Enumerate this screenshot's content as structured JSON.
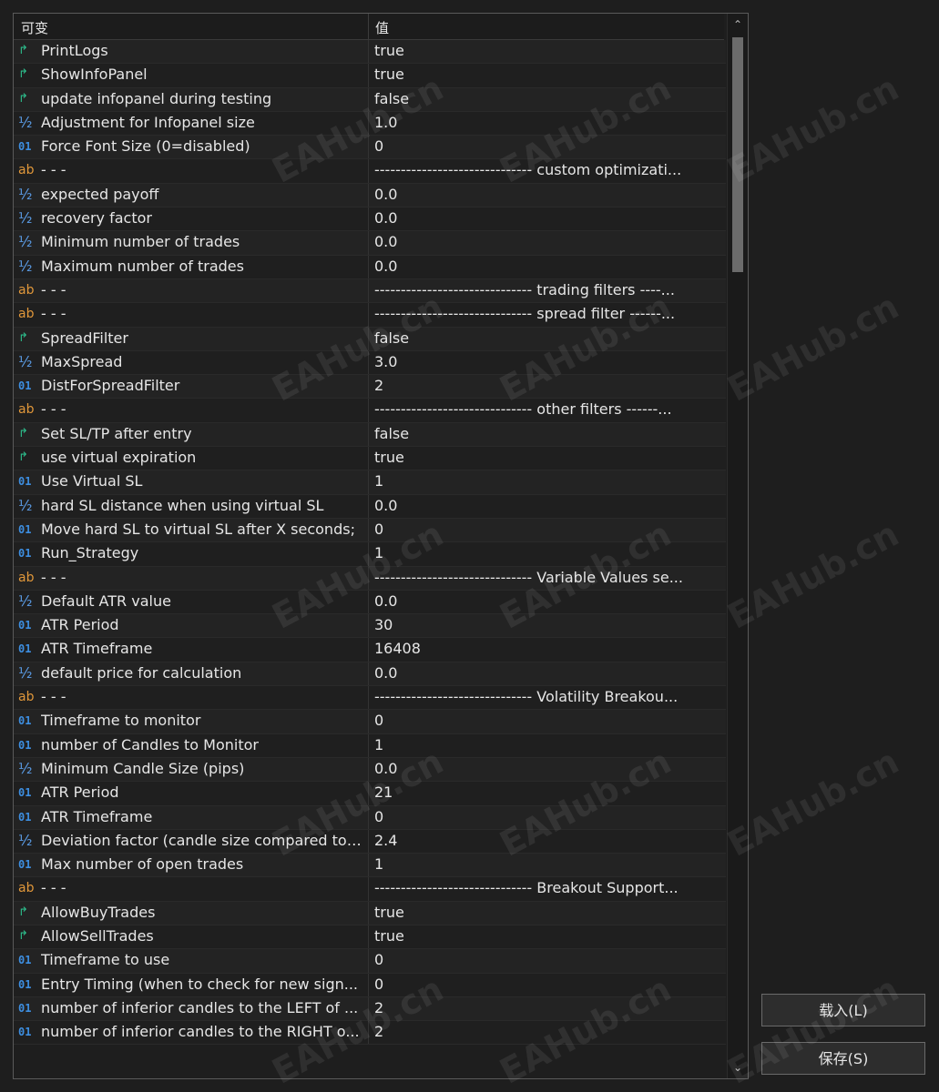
{
  "header": {
    "col_name": "可变",
    "col_value": "值"
  },
  "params": [
    {
      "type": "bool",
      "name": "PrintLogs",
      "value": "true"
    },
    {
      "type": "bool",
      "name": "ShowInfoPanel",
      "value": "true"
    },
    {
      "type": "bool",
      "name": "update infopanel during testing",
      "value": "false"
    },
    {
      "type": "double",
      "name": "Adjustment for Infopanel size",
      "value": "1.0"
    },
    {
      "type": "int",
      "name": "Force Font Size (0=disabled)",
      "value": "0"
    },
    {
      "type": "string",
      "name": "- - -",
      "value": "------------------------------ custom optimizati..."
    },
    {
      "type": "double",
      "name": "expected payoff",
      "value": "0.0"
    },
    {
      "type": "double",
      "name": "recovery factor",
      "value": "0.0"
    },
    {
      "type": "double",
      "name": "Minimum number of trades",
      "value": "0.0"
    },
    {
      "type": "double",
      "name": "Maximum number of trades",
      "value": "0.0"
    },
    {
      "type": "string",
      "name": "- - -",
      "value": "------------------------------ trading filters ----..."
    },
    {
      "type": "string",
      "name": "- - -",
      "value": "------------------------------ spread filter ------..."
    },
    {
      "type": "bool",
      "name": "SpreadFilter",
      "value": "false"
    },
    {
      "type": "double",
      "name": "MaxSpread",
      "value": "3.0"
    },
    {
      "type": "int",
      "name": "DistForSpreadFilter",
      "value": "2"
    },
    {
      "type": "string",
      "name": "- - -",
      "value": "------------------------------ other filters ------..."
    },
    {
      "type": "bool",
      "name": "Set SL/TP after entry",
      "value": "false"
    },
    {
      "type": "bool",
      "name": "use virtual expiration",
      "value": "true"
    },
    {
      "type": "int",
      "name": "Use Virtual SL",
      "value": "1"
    },
    {
      "type": "double",
      "name": "hard SL distance when using virtual SL",
      "value": "0.0"
    },
    {
      "type": "int",
      "name": "Move hard SL to virtual SL after X seconds;",
      "value": "0"
    },
    {
      "type": "int",
      "name": "Run_Strategy",
      "value": "1"
    },
    {
      "type": "string",
      "name": "- - -",
      "value": "------------------------------ Variable Values se..."
    },
    {
      "type": "double",
      "name": "Default ATR value",
      "value": "0.0"
    },
    {
      "type": "int",
      "name": "ATR Period",
      "value": "30"
    },
    {
      "type": "int",
      "name": "ATR Timeframe",
      "value": "16408"
    },
    {
      "type": "double",
      "name": "default price for calculation",
      "value": "0.0"
    },
    {
      "type": "string",
      "name": "- - -",
      "value": "------------------------------ Volatility Breakou..."
    },
    {
      "type": "int",
      "name": "Timeframe to monitor",
      "value": "0"
    },
    {
      "type": "int",
      "name": "number of Candles to Monitor",
      "value": "1"
    },
    {
      "type": "double",
      "name": "Minimum Candle Size (pips)",
      "value": "0.0"
    },
    {
      "type": "int",
      "name": "ATR Period",
      "value": "21"
    },
    {
      "type": "int",
      "name": "ATR Timeframe",
      "value": "0"
    },
    {
      "type": "double",
      "name": "Deviation factor (candle size compared to ...",
      "value": "2.4"
    },
    {
      "type": "int",
      "name": "Max number of open trades",
      "value": "1"
    },
    {
      "type": "string",
      "name": "- - -",
      "value": "------------------------------ Breakout Support..."
    },
    {
      "type": "bool",
      "name": "AllowBuyTrades",
      "value": "true"
    },
    {
      "type": "bool",
      "name": "AllowSellTrades",
      "value": "true"
    },
    {
      "type": "int",
      "name": "Timeframe to use",
      "value": "0"
    },
    {
      "type": "int",
      "name": "Entry Timing (when to check for new sign...",
      "value": "0"
    },
    {
      "type": "int",
      "name": "number of inferior candles to the LEFT of ...",
      "value": "2"
    },
    {
      "type": "int",
      "name": "number of inferior candles to the RIGHT o...",
      "value": "2"
    }
  ],
  "icons": {
    "bool": "↱",
    "int": "01",
    "double": "½",
    "string": "ab"
  },
  "buttons": {
    "load_label": "载入(L)",
    "save_label": "保存(S)"
  },
  "watermark": "EAHub.cn",
  "colors": {
    "bool_icon": "#2dbf8d",
    "int_icon": "#3d8ee0",
    "double_icon": "#5b9de8",
    "string_icon": "#e0973a"
  }
}
